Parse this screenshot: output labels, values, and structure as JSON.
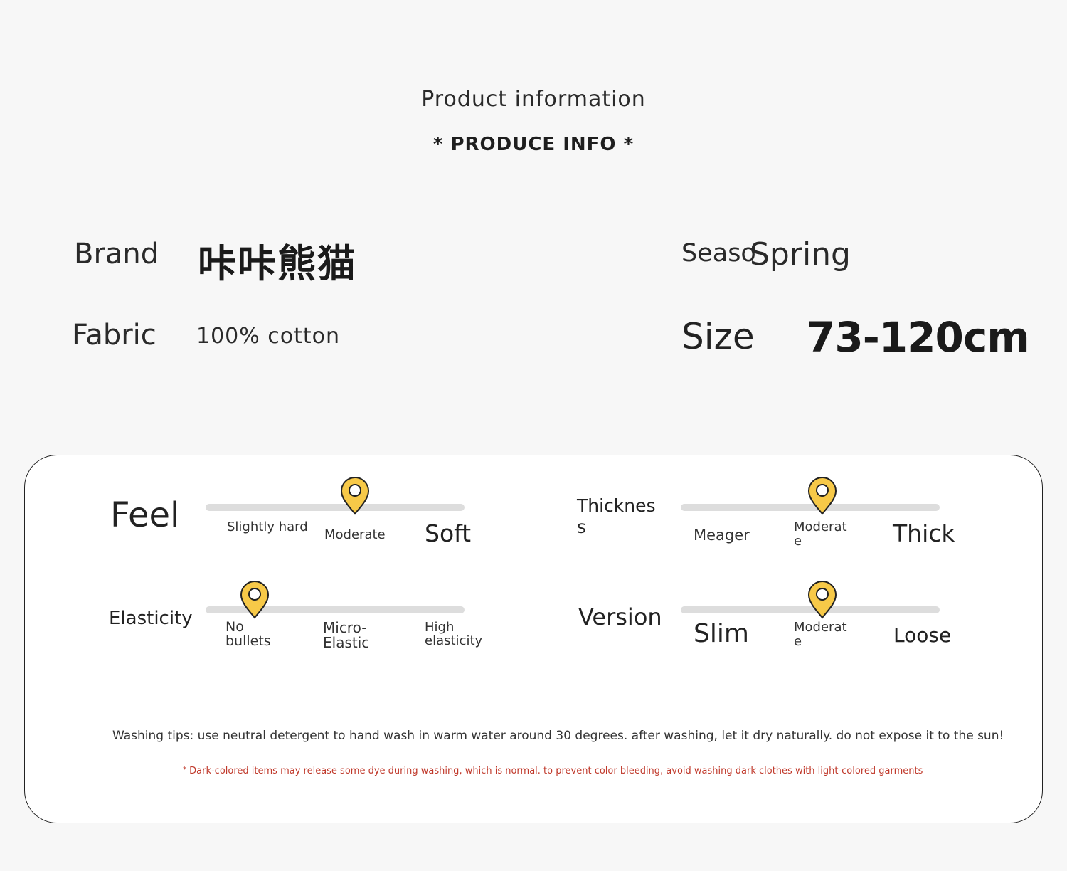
{
  "header": {
    "title": "Product information",
    "subtitle": "* PRODUCE INFO *"
  },
  "info": {
    "brand_label": "Brand",
    "brand_value": "咔咔熊猫",
    "season_label": "Seaso",
    "season_value": "Spring",
    "fabric_label": "Fabric",
    "fabric_value": "100% cotton",
    "size_label": "Size",
    "size_value": "73-120cm"
  },
  "attributes": {
    "feel": {
      "label": "Feel",
      "options": [
        "Slightly hard",
        "Moderate",
        "Soft"
      ],
      "selected": "Moderate"
    },
    "thickness": {
      "label": "Thickness",
      "label_line1": "Thicknes",
      "label_line2": "s",
      "options": [
        "Meager",
        "Moderate",
        "Thick"
      ],
      "option2_line1": "Moderat",
      "option2_line2": "e",
      "selected": "Moderate"
    },
    "elasticity": {
      "label": "Elasticity",
      "options": [
        "No bullets",
        "Micro-Elastic",
        "High elasticity"
      ],
      "selected": "No bullets"
    },
    "version": {
      "label": "Version",
      "options": [
        "Slim",
        "Moderate",
        "Loose"
      ],
      "option2_line1": "Moderat",
      "option2_line2": "e",
      "selected": "Moderate"
    }
  },
  "colors": {
    "pin_fill": "#f7c948",
    "pin_stroke": "#222222",
    "track": "#dddddd",
    "note": "#c0392b"
  },
  "icons": {
    "selector": "map-pin-icon"
  },
  "washing": {
    "tips": "Washing tips: use neutral detergent to hand wash in warm water around 30 degrees. after washing, let it dry naturally. do not expose it to the sun!",
    "note_mark": "*",
    "note": "Dark-colored items may release some dye during washing, which is normal. to prevent color bleeding, avoid washing dark clothes with light-colored garments"
  }
}
